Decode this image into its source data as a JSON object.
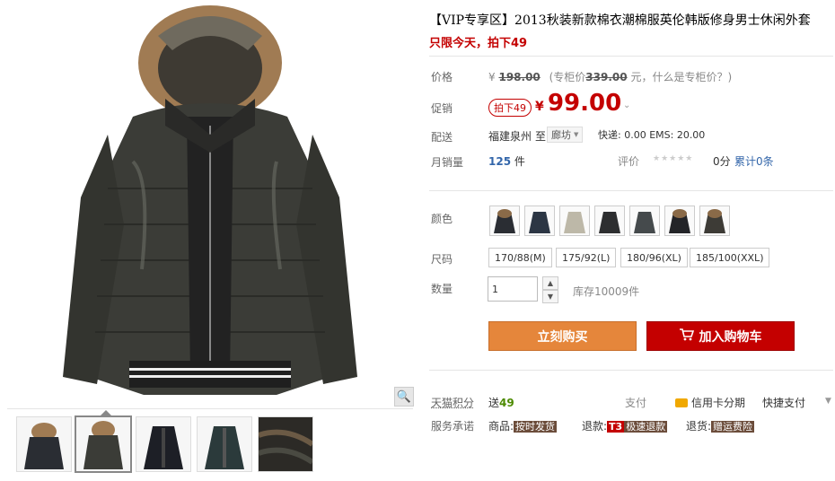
{
  "product": {
    "title": "【VIP专享区】2013秋装新款棉衣潮棉服英伦韩版修身男士休闲外套",
    "subtitle": "只限今天，拍下49"
  },
  "price": {
    "label": "价格",
    "currency": "¥",
    "original": "198.00",
    "counter_prefix": "(专柜价",
    "counter_price": "339.00",
    "counter_suffix": "元，什么是专柜价？)"
  },
  "promo": {
    "label": "促销",
    "tag": "拍下49",
    "currency": "¥",
    "price": "99.00"
  },
  "shipping": {
    "label": "配送",
    "from": "福建泉州",
    "to_word": "至",
    "city": "廊坊",
    "fees": "快递: 0.00 EMS: 20.00"
  },
  "sales": {
    "label": "月销量",
    "count": "125",
    "unit": "件",
    "rating_label": "评价",
    "stars": "★★★★★",
    "score": "0分",
    "reviews": "累计0条"
  },
  "color": {
    "label": "颜色",
    "swatches": [
      "#2a2d33",
      "#2c3644",
      "#bdb8a8",
      "#2d2e30",
      "#454a4c",
      "#232428",
      "#3d3b36"
    ]
  },
  "size": {
    "label": "尺码",
    "options": [
      "170/88(M)",
      "175/92(L)",
      "180/96(XL)",
      "185/100(XXL)"
    ]
  },
  "quantity": {
    "label": "数量",
    "value": "1",
    "stock": "库存10009件"
  },
  "buttons": {
    "buy": "立刻购买",
    "cart": "加入购物车"
  },
  "points": {
    "label": "天猫积分",
    "value_prefix": "送",
    "value": "49",
    "pay_label": "支付",
    "credit": "信用卡分期",
    "quickpay": "快捷支付"
  },
  "service": {
    "label": "服务承诺",
    "goods_label": "商品:",
    "goods_tag": "按时发货",
    "refund_label": "退款:",
    "refund_badge": "T3",
    "refund_tag": "极速退款",
    "return_label": "退货:",
    "return_tag": "赠运费险"
  },
  "colors": {
    "accent": "#c40000",
    "buy_orange": "#e5863b",
    "link_blue": "#3366aa"
  }
}
